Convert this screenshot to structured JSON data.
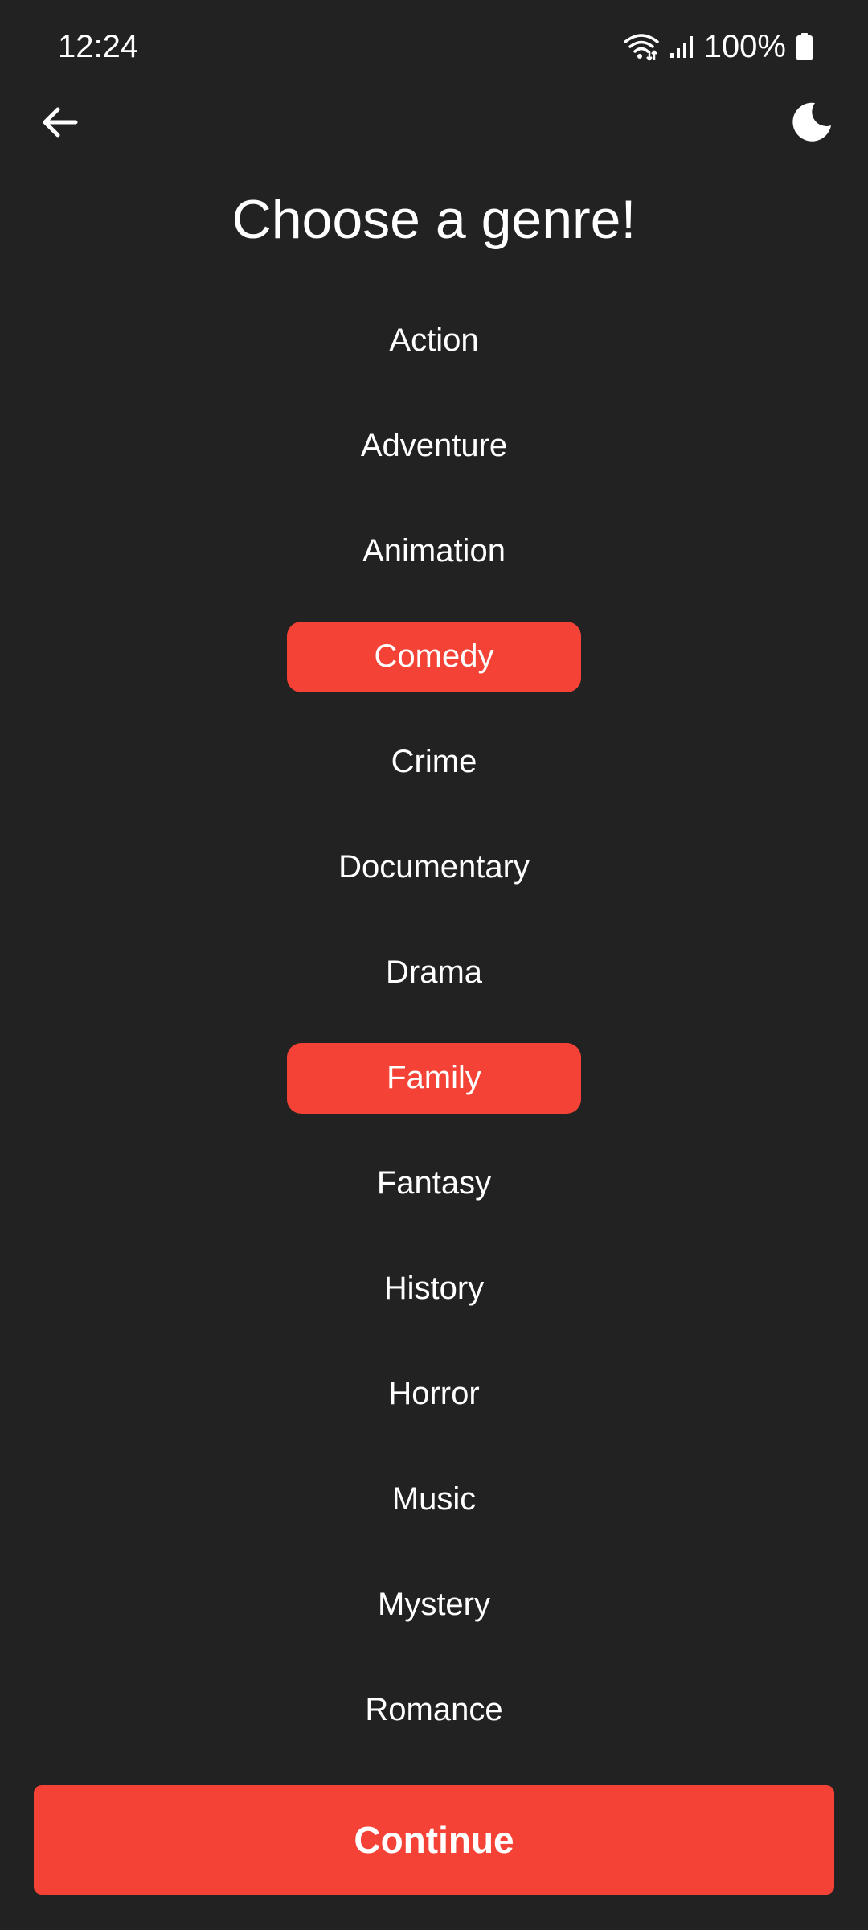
{
  "status_bar": {
    "time": "12:24",
    "battery": "100%",
    "icons": [
      "wifi-icon",
      "cellular-signal-icon",
      "battery-icon"
    ]
  },
  "app_bar": {
    "back_icon": "arrow-left-icon",
    "theme_icon": "moon-icon"
  },
  "page": {
    "title": "Choose a genre!"
  },
  "genres": [
    {
      "label": "Action",
      "selected": false
    },
    {
      "label": "Adventure",
      "selected": false
    },
    {
      "label": "Animation",
      "selected": false
    },
    {
      "label": "Comedy",
      "selected": true
    },
    {
      "label": "Crime",
      "selected": false
    },
    {
      "label": "Documentary",
      "selected": false
    },
    {
      "label": "Drama",
      "selected": false
    },
    {
      "label": "Family",
      "selected": true
    },
    {
      "label": "Fantasy",
      "selected": false
    },
    {
      "label": "History",
      "selected": false
    },
    {
      "label": "Horror",
      "selected": false
    },
    {
      "label": "Music",
      "selected": false
    },
    {
      "label": "Mystery",
      "selected": false
    },
    {
      "label": "Romance",
      "selected": false
    }
  ],
  "footer": {
    "continue_label": "Continue"
  },
  "colors": {
    "background": "#222222",
    "accent": "#f44336",
    "text": "#ffffff"
  }
}
